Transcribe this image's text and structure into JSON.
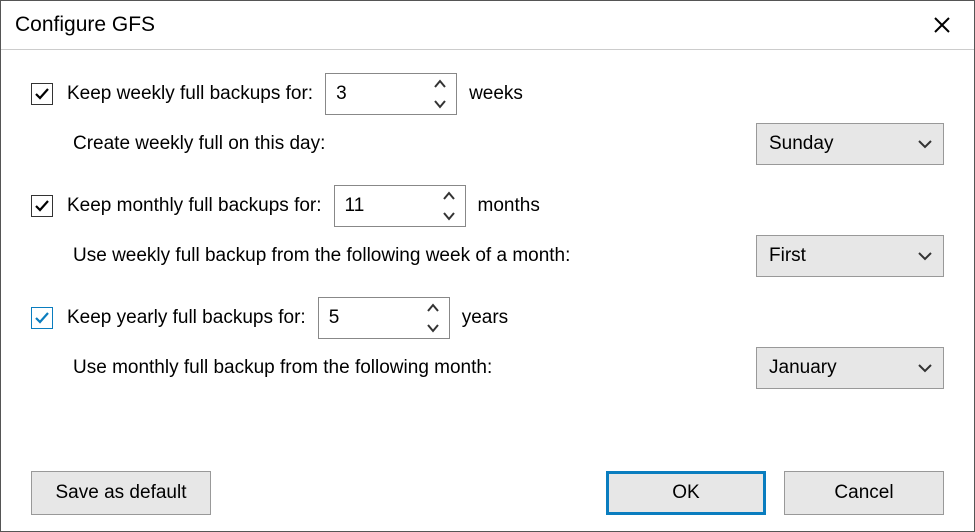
{
  "titlebar": {
    "title": "Configure GFS"
  },
  "weekly": {
    "keep_label": "Keep weekly full backups for:",
    "value": "3",
    "unit": "weeks",
    "sub_label": "Create weekly full on this day:",
    "dropdown_value": "Sunday"
  },
  "monthly": {
    "keep_label": "Keep monthly full backups for:",
    "value": "11",
    "unit": "months",
    "sub_label": "Use weekly full backup from the following week of a month:",
    "dropdown_value": "First"
  },
  "yearly": {
    "keep_label": "Keep yearly full backups for:",
    "value": "5",
    "unit": "years",
    "sub_label": "Use monthly full backup from the following month:",
    "dropdown_value": "January"
  },
  "buttons": {
    "save_default": "Save as default",
    "ok": "OK",
    "cancel": "Cancel"
  }
}
